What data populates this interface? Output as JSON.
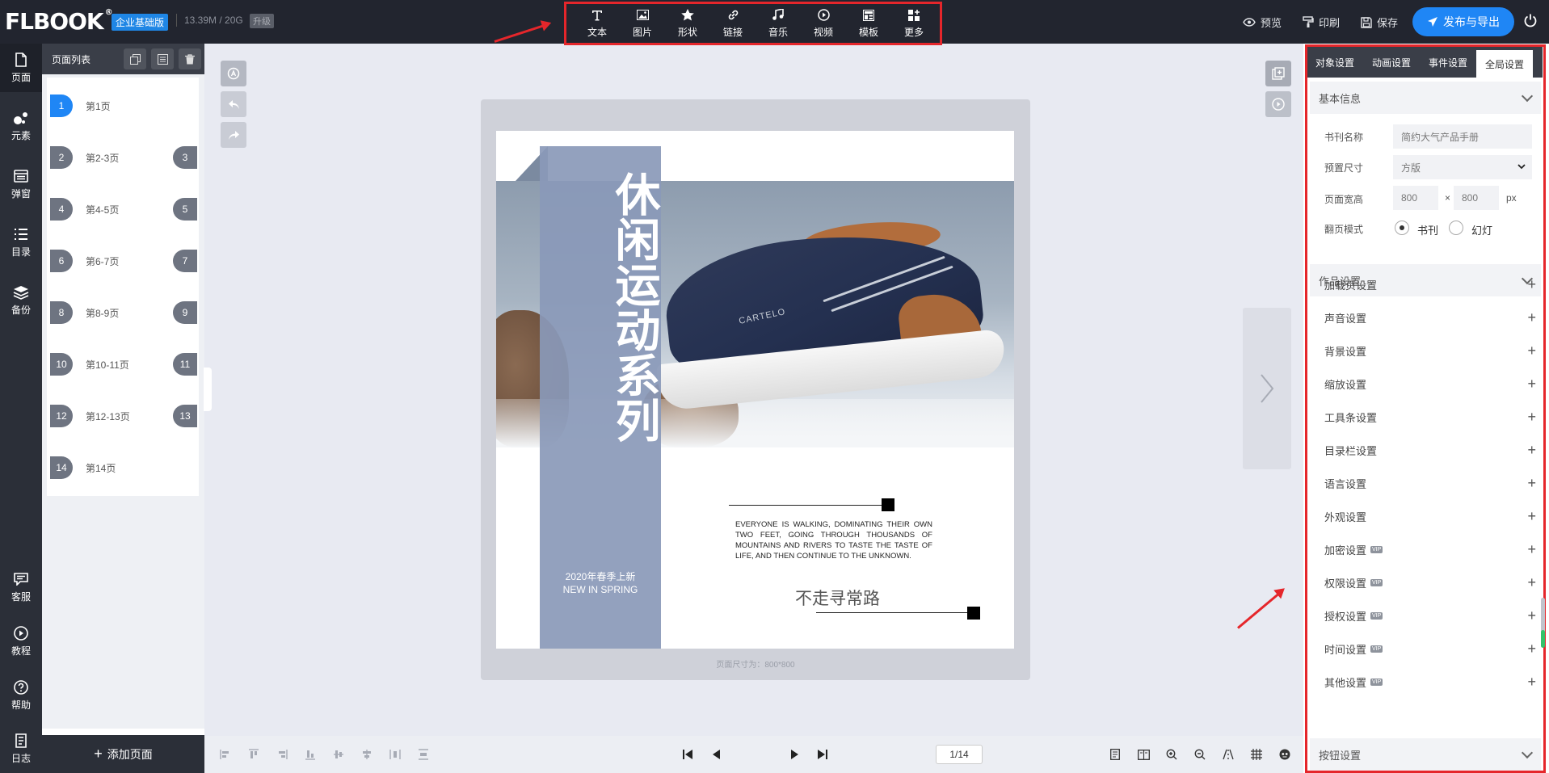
{
  "app": {
    "logo": "FLBOOK",
    "edition": "企业基础版",
    "storage": "13.39M / 20G",
    "upgrade": "升级"
  },
  "tools": [
    {
      "label": "文本",
      "icon": "text-icon"
    },
    {
      "label": "图片",
      "icon": "image-icon"
    },
    {
      "label": "形状",
      "icon": "star-icon"
    },
    {
      "label": "链接",
      "icon": "link-icon"
    },
    {
      "label": "音乐",
      "icon": "music-icon"
    },
    {
      "label": "视频",
      "icon": "video-icon"
    },
    {
      "label": "模板",
      "icon": "template-icon"
    },
    {
      "label": "更多",
      "icon": "more-icon"
    }
  ],
  "header_actions": {
    "preview": "预览",
    "print": "印刷",
    "save": "保存",
    "publish": "发布与导出"
  },
  "leftnav": [
    {
      "label": "页面",
      "icon": "page-icon"
    },
    {
      "label": "元素",
      "icon": "elements-icon"
    },
    {
      "label": "弹窗",
      "icon": "popup-icon"
    },
    {
      "label": "目录",
      "icon": "toc-icon"
    },
    {
      "label": "备份",
      "icon": "backup-icon"
    },
    {
      "label": "客服",
      "icon": "support-icon"
    },
    {
      "label": "教程",
      "icon": "tutorial-icon"
    },
    {
      "label": "帮助",
      "icon": "help-icon"
    },
    {
      "label": "日志",
      "icon": "log-icon"
    }
  ],
  "pagelist": {
    "title": "页面列表",
    "add_page": "添加页面",
    "rows": [
      {
        "num": "1",
        "num2": "",
        "label": "第1页"
      },
      {
        "num": "2",
        "num2": "3",
        "label": "第2-3页"
      },
      {
        "num": "4",
        "num2": "5",
        "label": "第4-5页"
      },
      {
        "num": "6",
        "num2": "7",
        "label": "第6-7页"
      },
      {
        "num": "8",
        "num2": "9",
        "label": "第8-9页"
      },
      {
        "num": "10",
        "num2": "11",
        "label": "第10-11页"
      },
      {
        "num": "12",
        "num2": "13",
        "label": "第12-13页"
      },
      {
        "num": "14",
        "num2": "",
        "label": "第14页"
      }
    ]
  },
  "canvas": {
    "title": "休闲运动系列",
    "season_cn": "2020年春季上新",
    "season_en": "NEW IN SPRING",
    "body": "EVERYONE IS WALKING, DOMINATING THEIR OWN TWO FEET, GOING THROUGH THOUSANDS OF MOUNTAINS AND RIVERS TO TASTE THE TASTE OF LIFE, AND THEN CONTINUE TO THE UNKNOWN.",
    "slogan": "不走寻常路",
    "brand": "CARTELO",
    "page_size": "页面尺寸为：800*800"
  },
  "rpanel": {
    "tabs": [
      "对象设置",
      "动画设置",
      "事件设置",
      "全局设置"
    ],
    "basic_info": "基本信息",
    "book_name_label": "书刊名称",
    "book_name_placeholder": "简约大气产品手册",
    "preset_label": "预置尺寸",
    "preset_value": "方版",
    "size_label": "页面宽高",
    "width": "800",
    "height": "800",
    "times": "×",
    "unit": "px",
    "flip_label": "翻页模式",
    "flip_book": "书刊",
    "flip_slide": "幻灯",
    "work_settings": "作品设置",
    "vip": "VIP",
    "settings": [
      {
        "label": "加载页设置",
        "vip": false
      },
      {
        "label": "声音设置",
        "vip": false
      },
      {
        "label": "背景设置",
        "vip": false
      },
      {
        "label": "缩放设置",
        "vip": false
      },
      {
        "label": "工具条设置",
        "vip": false
      },
      {
        "label": "目录栏设置",
        "vip": false
      },
      {
        "label": "语言设置",
        "vip": false
      },
      {
        "label": "外观设置",
        "vip": false
      },
      {
        "label": "加密设置",
        "vip": true
      },
      {
        "label": "权限设置",
        "vip": true
      },
      {
        "label": "授权设置",
        "vip": true
      },
      {
        "label": "时间设置",
        "vip": true
      },
      {
        "label": "其他设置",
        "vip": true
      }
    ],
    "button_settings": "按钮设置"
  },
  "pager": {
    "value": "1/14"
  }
}
